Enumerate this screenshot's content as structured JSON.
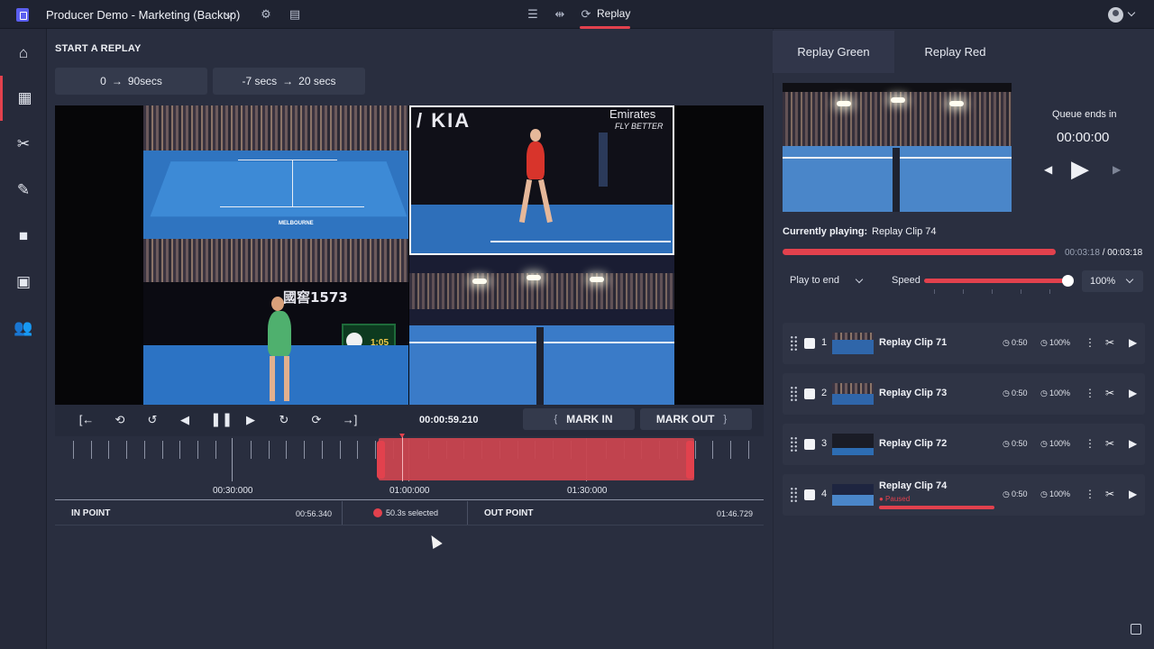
{
  "topbar": {
    "project_title": "Producer Demo - Marketing (Backup)",
    "mode_tab_label": "Replay",
    "icons": [
      "app-logo-icon",
      "settings-icon",
      "layout-icon",
      "list-icon",
      "split-icon",
      "replay-icon",
      "avatar",
      "chevron-down-icon"
    ]
  },
  "sidebar": {
    "items": [
      "home-icon",
      "replay-icon",
      "scissors-icon",
      "edit-icon",
      "folder-icon",
      "media-icon",
      "users-icon"
    ],
    "active_item": "replay-icon"
  },
  "main": {
    "section_title": "START A REPLAY",
    "presets": [
      {
        "from": "0",
        "to": "90secs"
      },
      {
        "from": "-7 secs",
        "to": "20 secs"
      }
    ],
    "arrow": "→",
    "timecode": "00:00:59.210",
    "mark_in_label": "MARK IN",
    "mark_out_label": "MARK OUT",
    "timeline_labels": [
      "00:30:000",
      "01:00:000",
      "01:30:000"
    ],
    "in_point_label": "IN POINT",
    "in_point_time": "00:56.340",
    "selection_text": "50.3s selected",
    "out_point_label": "OUT POINT",
    "out_point_time": "01:46.729",
    "video_banners": {
      "cam2_text": "Emirates",
      "cam2_sub": "FLY BETTER",
      "cam3_text": "國窖1573",
      "cam3_clock": "1:05",
      "cam1_text": "MELBOURNE"
    }
  },
  "right_panel": {
    "tabs": [
      "Replay Green",
      "Replay Red"
    ],
    "active_tab": "Replay Green",
    "queue_ends_label": "Queue ends in",
    "queue_ends_time": "00:00:00",
    "currently_playing_label": "Currently playing:",
    "currently_playing_clip": "Replay Clip 74",
    "elapsed_time": "00:03:18",
    "total_time": "/ 00:03:18",
    "progress_fraction": 1.0,
    "play_mode": "Play to end",
    "speed_label": "Speed",
    "speed_fraction": 1.0,
    "speed_value": "100%",
    "clips": [
      {
        "num": "1",
        "name": "Replay Clip 71",
        "duration": "0:50",
        "speed": "100%",
        "status": ""
      },
      {
        "num": "2",
        "name": "Replay Clip 73",
        "duration": "0:50",
        "speed": "100%",
        "status": ""
      },
      {
        "num": "3",
        "name": "Replay Clip 72",
        "duration": "0:50",
        "speed": "100%",
        "status": ""
      },
      {
        "num": "4",
        "name": "Replay Clip 74",
        "duration": "0:50",
        "speed": "100%",
        "status": "● Paused"
      }
    ]
  },
  "colors": {
    "accent": "#e2414d",
    "background": "#292e3f",
    "panel": "#2a2f40"
  }
}
